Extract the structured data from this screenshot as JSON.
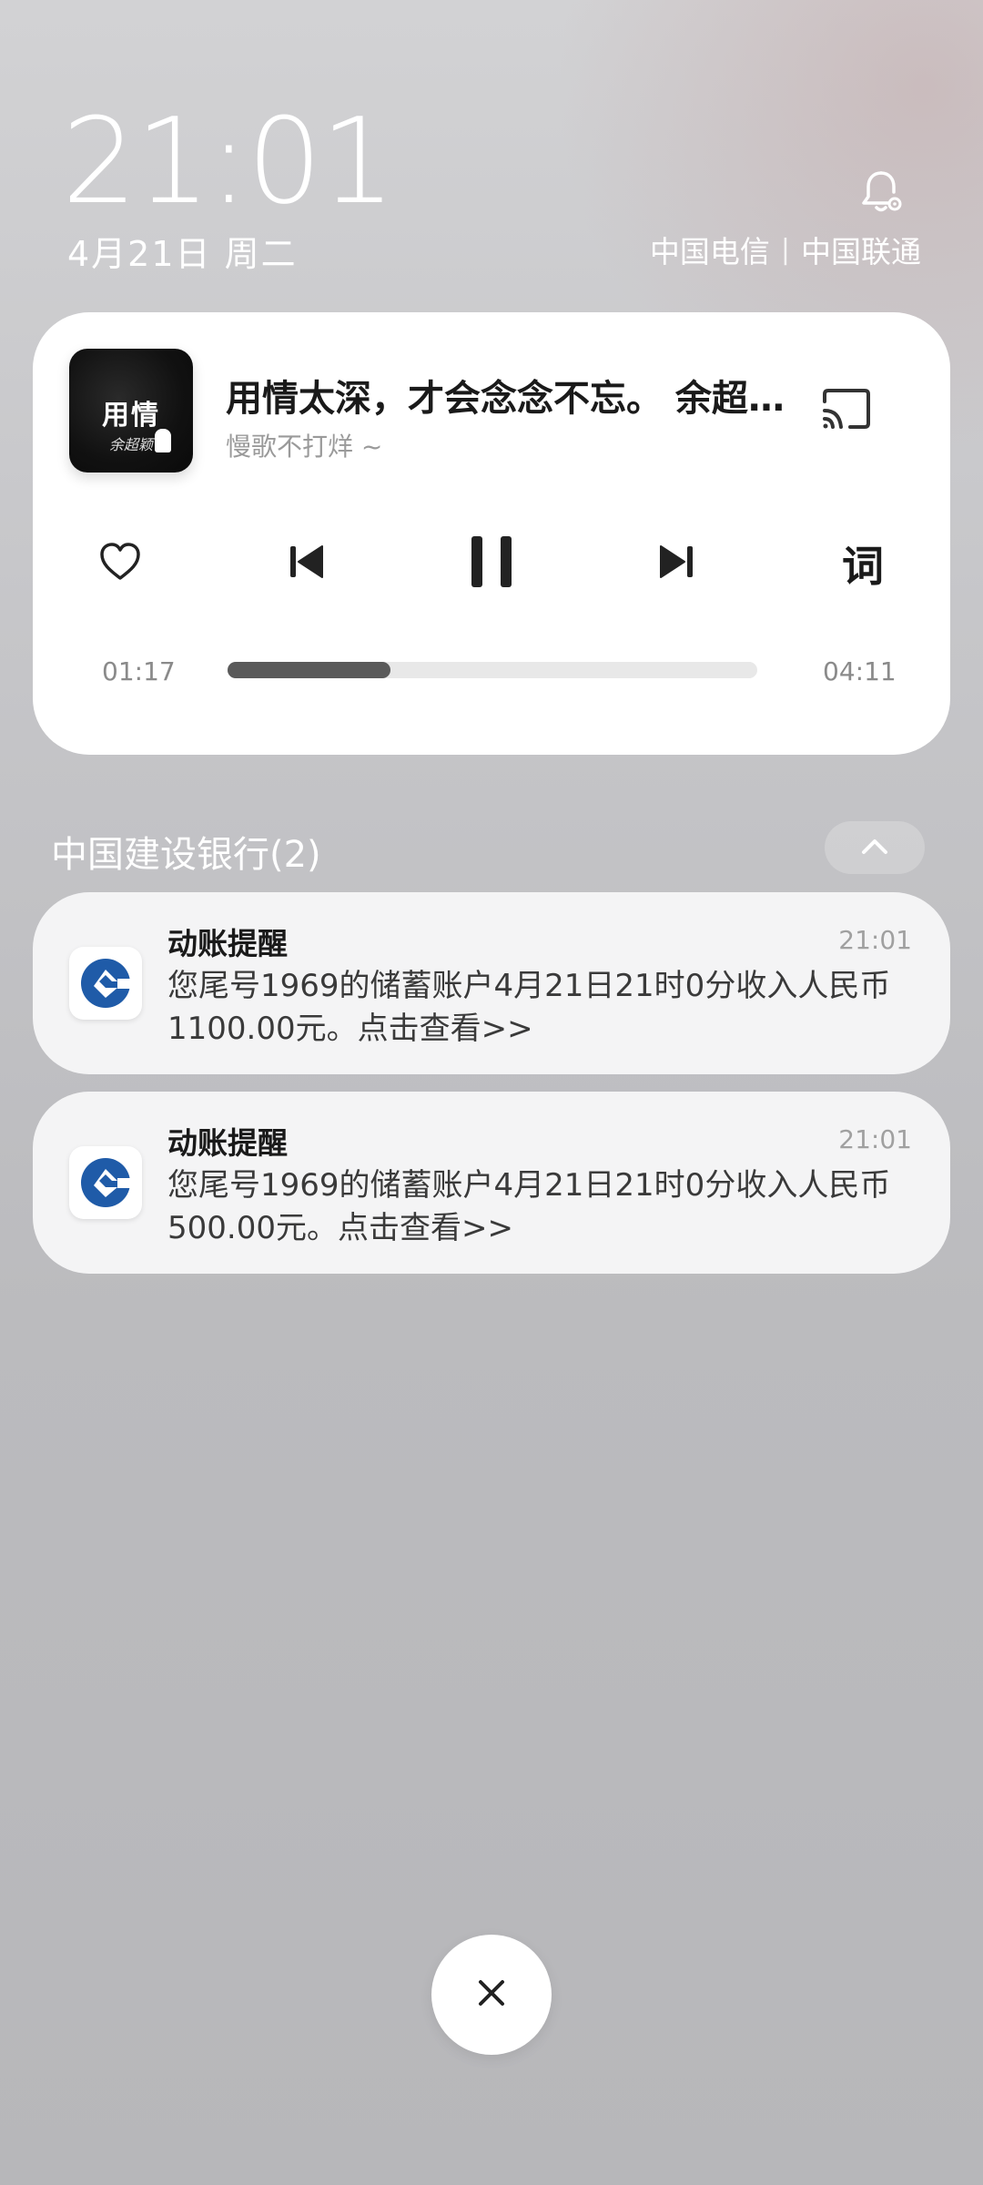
{
  "lockscreen": {
    "time": "21:01",
    "date": "4月21日 周二",
    "carriers": [
      "中国电信",
      "中国联通"
    ],
    "carrier_separator": "|"
  },
  "media": {
    "album_art_text": "用情",
    "album_art_subtext": "余超颖",
    "song_title": "用情太深，才会念念不忘。 余超颖《用情》",
    "artist": "慢歌不打烊 ~",
    "lyrics_label": "词",
    "elapsed": "01:17",
    "duration": "04:11",
    "progress_fraction": 0.307
  },
  "notification_group": {
    "title": "中国建设银行(2)",
    "notifications": [
      {
        "title": "动账提醒",
        "time": "21:01",
        "body": "您尾号1969的储蓄账户4月21日21时0分收入人民币1100.00元。点击查看>>"
      },
      {
        "title": "动账提醒",
        "time": "21:01",
        "body": "您尾号1969的储蓄账户4月21日21时0分收入人民币500.00元。点击查看>>"
      }
    ]
  },
  "icons": {
    "bell": "bell-settings-icon",
    "cast": "cast-icon",
    "like": "heart-icon",
    "prev": "skip-previous-icon",
    "pause": "pause-icon",
    "next": "skip-next-icon",
    "collapse": "chevron-up-icon",
    "dismiss": "close-icon",
    "bank": "ccb-logo-icon"
  },
  "colors": {
    "bank_blue": "#1f5ba8",
    "progress_fill": "#5a5a5a"
  }
}
